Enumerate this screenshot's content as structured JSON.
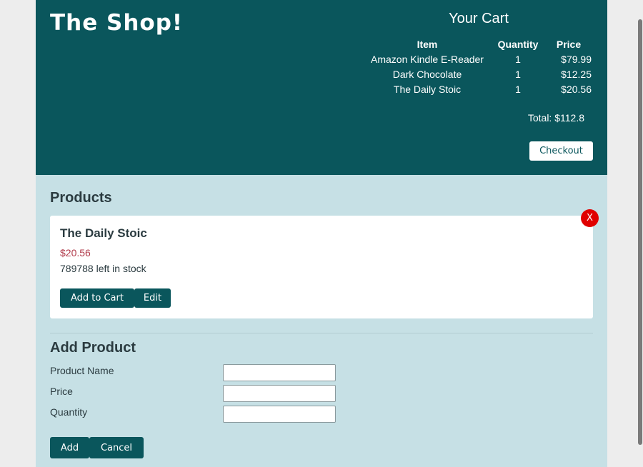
{
  "header": {
    "logo": "The Shop!",
    "cart_title": "Your Cart",
    "cart_columns": [
      "Item",
      "Quantity",
      "Price"
    ],
    "cart_items": [
      {
        "item": "Amazon Kindle E-Reader",
        "quantity": "1",
        "price": "$79.99"
      },
      {
        "item": "Dark Chocolate",
        "quantity": "1",
        "price": "$12.25"
      },
      {
        "item": "The Daily Stoic",
        "quantity": "1",
        "price": "$20.56"
      }
    ],
    "total": "Total: $112.8",
    "checkout_label": "Checkout"
  },
  "products": {
    "title": "Products",
    "items": [
      {
        "name": "The Daily Stoic",
        "price": "$20.56",
        "stock": "789788 left in stock",
        "add_to_cart_label": "Add to Cart",
        "edit_label": "Edit",
        "delete_label": "X"
      }
    ]
  },
  "add_product": {
    "title": "Add Product",
    "fields": [
      {
        "label": "Product Name",
        "value": ""
      },
      {
        "label": "Price",
        "value": ""
      },
      {
        "label": "Quantity",
        "value": ""
      }
    ],
    "add_label": "Add",
    "cancel_label": "Cancel"
  },
  "colors": {
    "header_bg": "#0a565c",
    "page_bg": "#c6e0e5",
    "price_text": "#b03a4a",
    "delete_button": "#e00000"
  }
}
